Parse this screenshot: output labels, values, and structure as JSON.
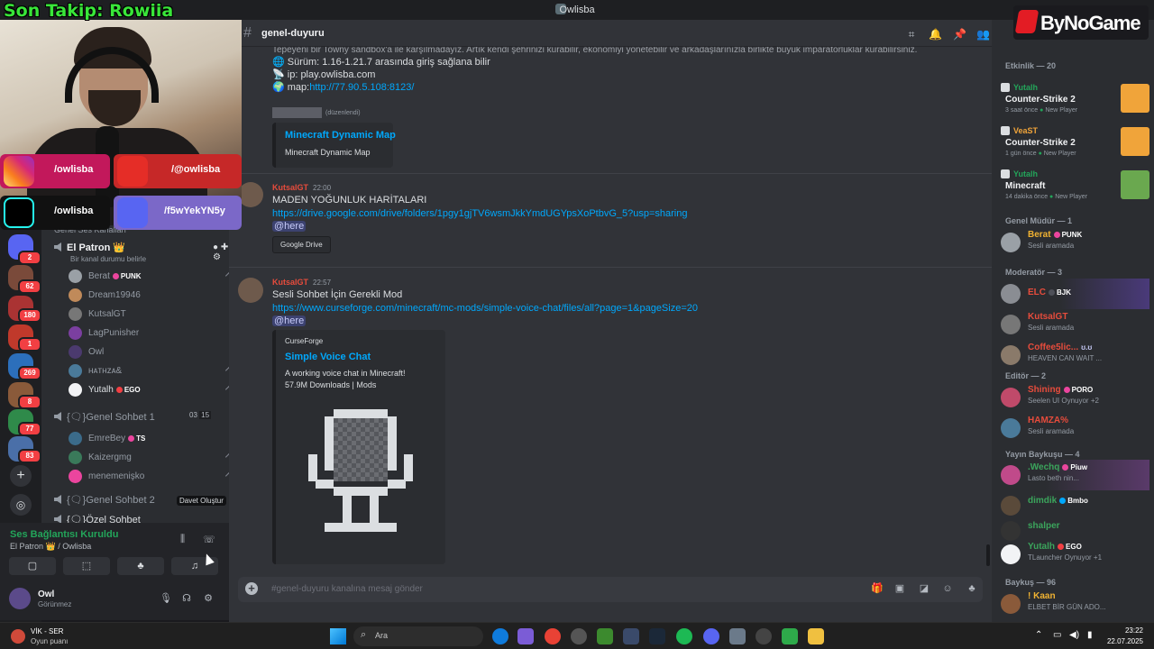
{
  "window": {
    "title": "Owlisba"
  },
  "overlay": {
    "follow_text": "Son Takip: Rowiia",
    "socials": [
      {
        "icon": "instagram-icon",
        "text": "/owlisba",
        "color": "#d6336c"
      },
      {
        "icon": "youtube-icon",
        "text": "/@owlisba",
        "color": "#e52d27"
      },
      {
        "icon": "tiktok-icon",
        "text": "/owlisba",
        "color": "#111111"
      },
      {
        "icon": "discord-icon",
        "text": "/f5wYekYN5y",
        "color": "#5865f2"
      }
    ],
    "brand": "ByNoGame"
  },
  "rail": {
    "badges": [
      "2",
      "62",
      "180",
      "1",
      "269",
      "8",
      "77",
      "83"
    ]
  },
  "channels": {
    "category_partial": "Genel Ses Kanalları",
    "el_patron": {
      "name": "El Patron",
      "status": "Bir kanal durumu belirle",
      "crown": "👑"
    },
    "el_patron_members": [
      {
        "name": "Berat",
        "tag": "PUNK"
      },
      {
        "name": "Dream19946",
        "tag": ""
      },
      {
        "name": "KutsalGT",
        "tag": ""
      },
      {
        "name": "LagPunisher",
        "tag": ""
      },
      {
        "name": "Owl",
        "tag": ""
      },
      {
        "name": "ʜᴀтнᴢᴀ&",
        "tag": ""
      },
      {
        "name": "Yutalh",
        "tag": "EGO"
      }
    ],
    "genel_sohbet_1": {
      "name": "{🗨}Genel Sohbet 1",
      "count_a": "03",
      "count_b": "15"
    },
    "genel_sohbet_1_members": [
      {
        "name": "EmreBey",
        "tag": "TS"
      },
      {
        "name": "Kaizergmg",
        "tag": ""
      },
      {
        "name": "menemenişko",
        "tag": ""
      }
    ],
    "genel_sohbet_2": {
      "name": "{🗨}Genel Sohbet 2",
      "tooltip": "Davet Oluştur"
    },
    "ozel_sohbet": {
      "name": "{🗨}Özel Sohbet"
    }
  },
  "voice_panel": {
    "connected": "Ses Bağlantısı Kuruldu",
    "location": "El Patron 👑 / Owlisba"
  },
  "user_panel": {
    "name": "Owl",
    "status": "Görünmez"
  },
  "chat": {
    "channel": "genel-duyuru",
    "intro_line": "Tepeyeni bir Towny sandbox'a ile karşılmadayız. Artık kendi şehrinizi kurabilir, ekonomiyi yönetebilir ve arkadaşlarınızla birlikte büyük imparatorluklar kurabilirsiniz.",
    "version_line": "Sürüm: 1.16-1.21.7 arasında giriş sağlana bilir",
    "ip_line": "ip: play.owlisba.com",
    "map_label": "map:",
    "map_url": "http://77.90.5.108:8123/",
    "edited_note": "(düzenlendi)",
    "embed1": {
      "title": "Minecraft Dynamic Map",
      "text": "Minecraft Dynamic Map"
    },
    "msg2": {
      "author": "KutsalGT",
      "time": "22:00",
      "text": "MADEN YOĞUNLUK HARİTALARI",
      "link": "https://drive.google.com/drive/folders/1pgy1gjTV6wsmJkkYmdUGYpsXoPtbvG_5?usp=sharing",
      "mention": "@here",
      "chip": "Google Drive"
    },
    "msg3": {
      "author": "KutsalGT",
      "time": "22:57",
      "text": "Sesli Sohbet İçin Gerekli Mod",
      "link": "https://www.curseforge.com/minecraft/mc-mods/simple-voice-chat/files/all?page=1&pageSize=20",
      "mention": "@here",
      "embed": {
        "provider": "CurseForge",
        "title": "Simple Voice Chat",
        "desc": "A working voice chat in Minecraft!",
        "meta": "57.9M Downloads | Mods"
      }
    },
    "input_placeholder": "#genel-duyuru kanalına mesaj gönder"
  },
  "members": {
    "activity_header": "Etkinlik — 20",
    "activities": [
      {
        "user": "Yutalh",
        "game": "Counter-Strike 2",
        "meta": "3 saat önce",
        "tag": "New Player",
        "color": "#f0a43a"
      },
      {
        "user": "VeaST",
        "game": "Counter-Strike 2",
        "meta": "1 gün önce",
        "tag": "New Player",
        "color": "#f0a43a"
      },
      {
        "user": "Yutalh",
        "game": "Minecraft",
        "meta": "14 dakika önce",
        "tag": "New Player",
        "color": "#6aa84f"
      }
    ],
    "groups": [
      {
        "header": "Genel Müdür — 1",
        "items": [
          {
            "name": "Berat",
            "tag": "PUNK",
            "sub": "Sesli aramada",
            "color": "#f0b232"
          }
        ]
      },
      {
        "header": "Moderatör — 3",
        "items": [
          {
            "name": "ELC",
            "tag": "BJK",
            "sub": "",
            "color": "#e74c3c"
          },
          {
            "name": "KutsalGT",
            "tag": "",
            "sub": "Sesli aramada",
            "color": "#e74c3c"
          },
          {
            "name": "Coffee5lic...",
            "tag": "ʊ.ʊ",
            "sub": "HEAVEN CAN WAIT ...",
            "color": "#e74c3c"
          }
        ]
      },
      {
        "header": "Editör — 2",
        "items": [
          {
            "name": "Shining",
            "tag": "PORO",
            "sub": "Seelen UI Oynuyor +2",
            "color": "#e74c3c"
          },
          {
            "name": "HAMZA%",
            "tag": "",
            "sub": "Sesli aramada",
            "color": "#e74c3c"
          }
        ]
      },
      {
        "header": "Yayın Baykuşu — 4",
        "items": [
          {
            "name": ".Wechq",
            "tag": "Piuw",
            "sub": "Lasto beth nin...",
            "color": "#3ba55c"
          },
          {
            "name": "dimdik",
            "tag": "Bmbo",
            "sub": "",
            "color": "#3ba55c"
          },
          {
            "name": "shalper",
            "tag": "",
            "sub": "",
            "color": "#3ba55c"
          },
          {
            "name": "Yutalh",
            "tag": "EGO",
            "sub": "TLauncher Oynuyor +1",
            "color": "#3ba55c"
          }
        ]
      },
      {
        "header": "Baykuş — 96",
        "items": [
          {
            "name": "! Kaan",
            "tag": "",
            "sub": "ELBET BİR GÜN ADO...",
            "color": "#f0b232"
          }
        ]
      }
    ]
  },
  "taskbar": {
    "weather_title": "VİK - SER",
    "weather_sub": "Oyun puanı",
    "search": "Ara",
    "time": "23:22",
    "date": "22.07.2025"
  },
  "colors": {
    "bg": "#313338",
    "sidebar": "#2b2d31",
    "rail": "#1e1f22",
    "link": "#00a8fc",
    "online": "#23a55a",
    "follow": "#39e639"
  }
}
